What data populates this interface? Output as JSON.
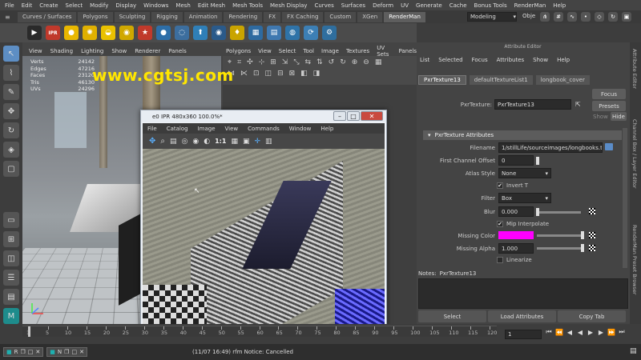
{
  "menubar": [
    "File",
    "Edit",
    "Create",
    "Select",
    "Modify",
    "Display",
    "Windows",
    "Mesh",
    "Edit Mesh",
    "Mesh Tools",
    "Mesh Display",
    "Curves",
    "Surfaces",
    "Deform",
    "UV",
    "Generate",
    "Cache",
    "Bonus Tools",
    "RenderMan",
    "Help"
  ],
  "shelf_tabs": [
    "Curves / Surfaces",
    "Polygons",
    "Sculpting",
    "Rigging",
    "Animation",
    "Rendering",
    "FX",
    "FX Caching",
    "Custom",
    "XGen",
    "RenderMan"
  ],
  "active_shelf_tab": "RenderMan",
  "mode_selector": "Modeling",
  "object_label": "Obje",
  "shelf_icons": [
    "render-icon",
    "ipr-icon",
    "light-icon",
    "sun-icon",
    "environment-light-icon",
    "sky-icon",
    "star-icon",
    "sphere-icon",
    "dotted-sphere-icon",
    "arrow-up-icon",
    "eye-icon",
    "bulb-icon",
    "grid-icon",
    "document-icon",
    "globe-icon",
    "refresh-icon",
    "settings-icon"
  ],
  "viewport1": {
    "menu": [
      "View",
      "Shading",
      "Lighting",
      "Show",
      "Renderer",
      "Panels"
    ],
    "hud": [
      {
        "label": "Verts",
        "value": "24142"
      },
      {
        "label": "Edges",
        "value": "47216"
      },
      {
        "label": "Faces",
        "value": "23120"
      },
      {
        "label": "Tris",
        "value": "46130"
      },
      {
        "label": "UVs",
        "value": "24296"
      }
    ]
  },
  "viewport2": {
    "menu": [
      "Polygons",
      "View",
      "Select",
      "Tool",
      "Image",
      "Textures",
      "UV Sets",
      "Panels"
    ]
  },
  "ipr": {
    "title": "e0 IPR 480x360 100.0%*",
    "menu": [
      "File",
      "Catalog",
      "Image",
      "View",
      "Commands",
      "Window",
      "Help"
    ],
    "zoom_label": "1:1",
    "watermark": "www.cgtsj.com"
  },
  "attribute_editor": {
    "title": "Attribute Editor",
    "menu": [
      "List",
      "Selected",
      "Focus",
      "Attributes",
      "Show",
      "Help"
    ],
    "tabs": [
      "PxrTexture13",
      "defaultTextureList1",
      "longbook_cover"
    ],
    "node_label": "PxrTexture:",
    "node_name": "PxrTexture13",
    "focus": "Focus",
    "presets": "Presets",
    "show": "Show",
    "hide": "Hide",
    "section": "PxrTexture Attributes",
    "filename_label": "Filename",
    "filename": "1/stillLife/sourceimages/longbooks.tga",
    "first_channel_label": "First Channel Offset",
    "first_channel_value": "0",
    "atlas_label": "Atlas Style",
    "atlas_value": "None",
    "invert_t": "Invert T",
    "filter_label": "Filter",
    "filter_value": "Box",
    "blur_label": "Blur",
    "blur_value": "0.000",
    "mip_label": "Mip Interpolate",
    "missing_color_label": "Missing Color",
    "missing_color": "#ff00ff",
    "missing_alpha_label": "Missing Alpha",
    "missing_alpha_value": "1.000",
    "linearize": "Linearize",
    "notes_label": "Notes:",
    "notes_node": "PxrTexture13",
    "buttons": [
      "Select",
      "Load Attributes",
      "Copy Tab"
    ]
  },
  "side_tabs": [
    "Attribute Editor",
    "Channel Box / Layer Editor",
    "RenderMan Preset Browser"
  ],
  "timeline": {
    "ticks": [
      "1",
      "5",
      "10",
      "15",
      "20",
      "25",
      "30",
      "35",
      "40",
      "45",
      "50",
      "55",
      "60",
      "65",
      "70",
      "75",
      "80",
      "85",
      "90",
      "95",
      "100",
      "105",
      "110",
      "115",
      "120"
    ],
    "current_frame": "1"
  },
  "status": {
    "tasks": [
      "R",
      "N"
    ],
    "message": "(11/07 16:49) rfm Notice: Cancelled"
  }
}
